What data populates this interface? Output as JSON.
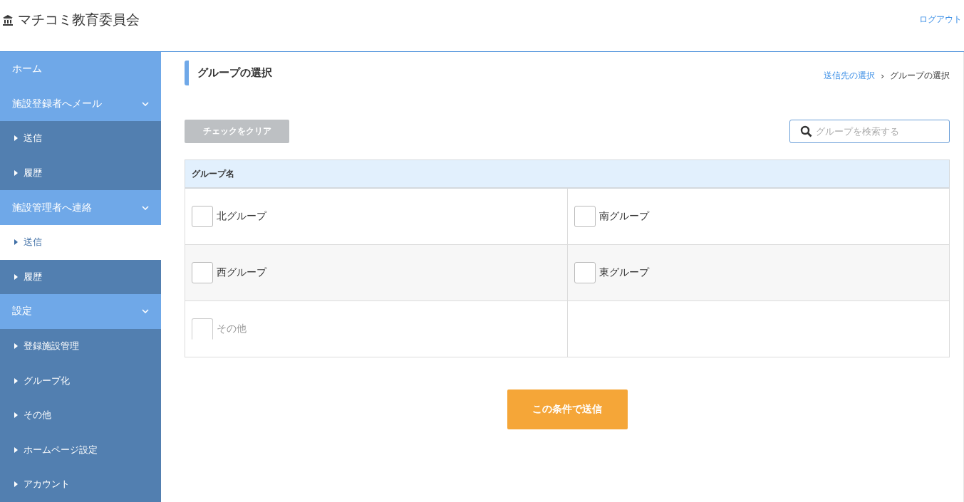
{
  "header": {
    "title": "マチコミ教育委員会",
    "logout": "ログアウト"
  },
  "sidebar": {
    "items": [
      {
        "label": "ホーム"
      },
      {
        "label": "施設登録者へメール",
        "expanded": true,
        "children": [
          {
            "label": "送信",
            "selected": false
          },
          {
            "label": "履歴",
            "selected": false
          }
        ]
      },
      {
        "label": "施設管理者へ連絡",
        "expanded": true,
        "children": [
          {
            "label": "送信",
            "selected": true
          },
          {
            "label": "履歴",
            "selected": false
          }
        ]
      },
      {
        "label": "設定",
        "expanded": true,
        "children": [
          {
            "label": "登録施設管理",
            "selected": false
          },
          {
            "label": "グループ化",
            "selected": false
          },
          {
            "label": "その他",
            "selected": false
          },
          {
            "label": "ホームページ設定",
            "selected": false
          },
          {
            "label": "アカウント",
            "selected": false
          }
        ]
      }
    ]
  },
  "page": {
    "title": "グループの選択",
    "breadcrumb": [
      {
        "label": "送信先の選択",
        "link": true
      },
      {
        "label": "グループの選択",
        "link": false
      }
    ],
    "breadcrumb_separator": "›",
    "clear_button": {
      "label": "チェックをクリア",
      "disabled": true
    },
    "search": {
      "placeholder": "グループを検索する"
    },
    "table": {
      "columns": [
        "グループ名"
      ],
      "groups": [
        {
          "name": "北グループ",
          "checked": false,
          "disabled": false
        },
        {
          "name": "南グループ",
          "checked": false,
          "disabled": false
        },
        {
          "name": "西グループ",
          "checked": false,
          "disabled": false
        },
        {
          "name": "東グループ",
          "checked": false,
          "disabled": false
        },
        {
          "name": "その他",
          "checked": false,
          "disabled": true
        }
      ]
    },
    "submit_button": {
      "label": "この条件で送信"
    }
  }
}
